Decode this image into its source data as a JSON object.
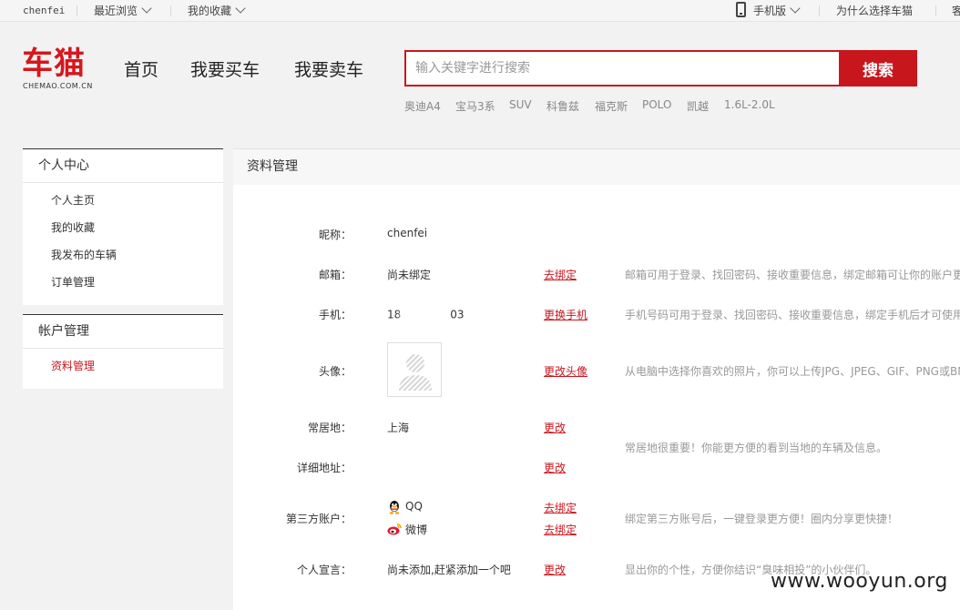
{
  "topbar": {
    "username": "chenfei",
    "recent": "最近浏览",
    "favorites": "我的收藏",
    "mobile": "手机版",
    "why": "为什么选择车猫",
    "more": "客"
  },
  "logo": {
    "cn": "车猫",
    "en": "CHEMAO.COM.CN"
  },
  "nav": [
    "首页",
    "我要买车",
    "我要卖车"
  ],
  "search": {
    "placeholder": "输入关键字进行搜索",
    "button": "搜索"
  },
  "hot_keywords": [
    "奥迪A4",
    "宝马3系",
    "SUV",
    "科鲁兹",
    "福克斯",
    "POLO",
    "凯越",
    "1.6L-2.0L"
  ],
  "sidebar": {
    "personal_center": {
      "title": "个人中心",
      "items": [
        "个人主页",
        "我的收藏",
        "我发布的车辆",
        "订单管理"
      ]
    },
    "account": {
      "title": "帐户管理",
      "items": [
        "资料管理"
      ]
    }
  },
  "main": {
    "title": "资料管理",
    "nickname": {
      "label": "昵称：",
      "value": "chenfei"
    },
    "email": {
      "label": "邮箱：",
      "value": "尚未绑定",
      "action": "去绑定",
      "desc": "邮箱可用于登录、找回密码、接收重要信息，绑定邮箱可让你的账户更"
    },
    "phone": {
      "label": "手机：",
      "value_prefix": "18",
      "value_suffix": "03",
      "action": "更换手机",
      "desc": "手机号码可用于登录、找回密码、接收重要信息，绑定手机后才可使用"
    },
    "avatar": {
      "label": "头像：",
      "action": "更改头像",
      "desc": "从电脑中选择你喜欢的照片，你可以上传JPG、JPEG、GIF、PNG或BM"
    },
    "residence": {
      "label": "常居地：",
      "value": "上海",
      "action": "更改"
    },
    "address": {
      "label": "详细地址：",
      "action": "更改"
    },
    "location_desc": "常居地很重要！你能更方便的看到当地的车辆及信息。",
    "third_party": {
      "label": "第三方账户：",
      "qq": "QQ",
      "weibo": "微博",
      "qq_action": "去绑定",
      "weibo_action": "去绑定",
      "desc": "绑定第三方账号后，一键登录更方便！圈内分享更快捷！"
    },
    "declaration": {
      "label": "个人宣言：",
      "value": "尚未添加,赶紧添加一个吧",
      "action": "更改",
      "desc": "显出你的个性，方便你结识“臭味相投”的小伙伴们。"
    }
  },
  "watermark": "www.wooyun.org",
  "colors": {
    "brand_red": "#c8161d",
    "desc_gray": "#999999"
  }
}
